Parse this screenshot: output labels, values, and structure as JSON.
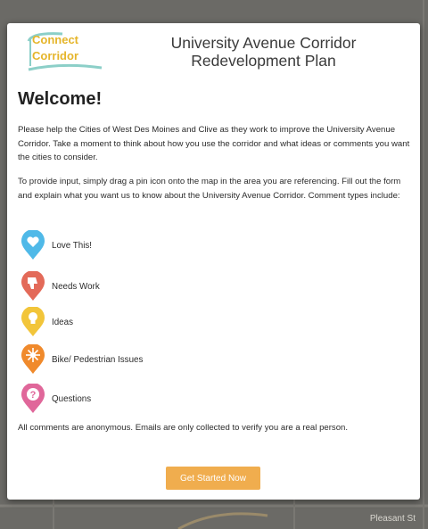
{
  "header": {
    "logo_line1": "Connect",
    "logo_line2": "Corridor",
    "title": "University Avenue Corridor Redevelopment Plan"
  },
  "welcome": {
    "heading": "Welcome!",
    "intro": "Please help the Cities of West Des Moines and Clive as they work to improve the University Avenue Corridor.  Take a moment to think about how you use the corridor and what ideas or comments you want the cities to consider.",
    "instructions": "To provide input, simply drag a pin icon onto the map in the area you are referencing. Fill out the form and explain what you want us to know about the University Avenue Corridor. Comment types include:",
    "comment_types": [
      {
        "label": "Love This!",
        "icon": "heart-pin-icon",
        "color": "#4fb9e8"
      },
      {
        "label": "Needs Work",
        "icon": "thumbs-down-pin-icon",
        "color": "#e36a59"
      },
      {
        "label": "Ideas",
        "icon": "lightbulb-pin-icon",
        "color": "#f2c53a"
      },
      {
        "label": "Bike/ Pedestrian Issues",
        "icon": "sun-pin-icon",
        "color": "#f08a2c"
      },
      {
        "label": "Questions",
        "icon": "question-pin-icon",
        "color": "#e0679a"
      }
    ],
    "disclaimer": "All comments are anonymous.  Emails are only collected to verify you are a real person.",
    "button_label": "Get Started Now"
  },
  "map": {
    "street_label": "Pleasant St"
  },
  "colors": {
    "accent": "#f0ad4e",
    "overlay": "#6b6a66"
  }
}
